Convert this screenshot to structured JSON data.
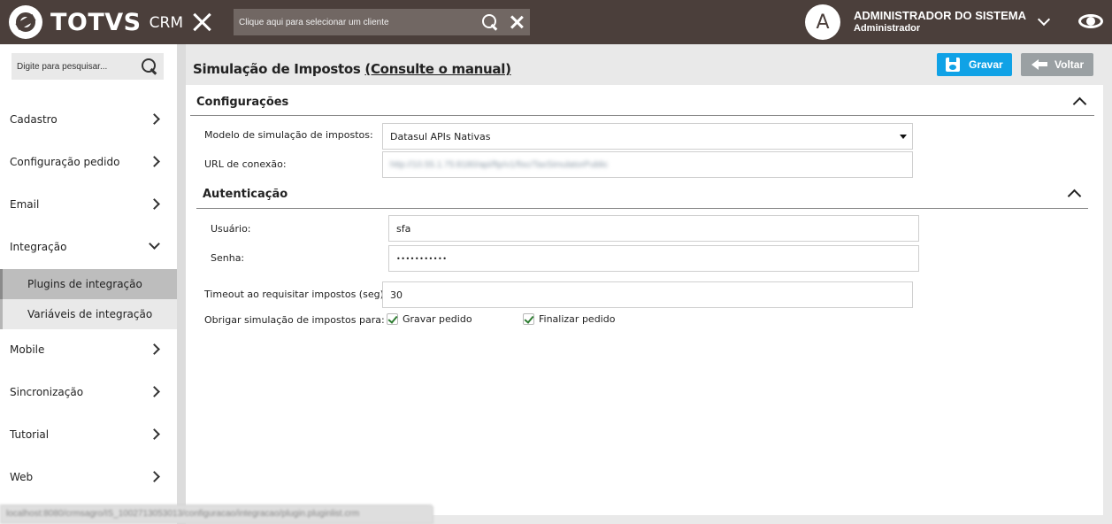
{
  "topbar": {
    "brand": "TOTVS",
    "product": "CRM",
    "client_placeholder": "Clique aqui para selecionar um cliente",
    "avatar_letter": "A",
    "user_name": "ADMINISTRADOR DO SISTEMA",
    "user_role": "Administrador"
  },
  "sidebar": {
    "search_placeholder": "Digite para pesquisar...",
    "items": [
      {
        "label": "Cadastro"
      },
      {
        "label": "Configuração pedido"
      },
      {
        "label": "Email"
      },
      {
        "label": "Integração"
      },
      {
        "label": "Mobile"
      },
      {
        "label": "Sincronização"
      },
      {
        "label": "Tutorial"
      },
      {
        "label": "Web"
      }
    ],
    "subitems": [
      {
        "label": "Plugins de integração",
        "active": true
      },
      {
        "label": "Variáveis de integração",
        "active": false
      }
    ],
    "status_url": "localhost:8080/crmsagro/IS_1002713053013/configuracao/integracao/plugin.pluginlist.crm"
  },
  "header": {
    "title": "Simulação de Impostos",
    "manual_link": "(Consulte o manual)",
    "save_label": "Gravar",
    "back_label": "Voltar"
  },
  "config": {
    "section_title": "Configurações",
    "model_label": "Modelo de simulação de impostos:",
    "model_value": "Datasul APIs Nativas",
    "url_label": "URL de conexão:",
    "url_value": "http://10.55.1.75:8180/api/ftp/v1/fisc/TaxSimulatorPublic"
  },
  "auth": {
    "section_title": "Autenticação",
    "user_label": "Usuário:",
    "user_value": "sfa",
    "password_label": "Senha:",
    "password_value": "•••••••••••"
  },
  "timeout": {
    "label": "Timeout ao requisitar impostos (seg):",
    "value": "30"
  },
  "force": {
    "label": "Obrigar simulação de impostos para:",
    "options": [
      {
        "label": "Gravar pedido",
        "checked": true
      },
      {
        "label": "Finalizar pedido",
        "checked": true
      }
    ]
  },
  "colors": {
    "topbar": "#4b3f3b",
    "save_button": "#10a2e6",
    "back_button": "#9aa0a3"
  }
}
